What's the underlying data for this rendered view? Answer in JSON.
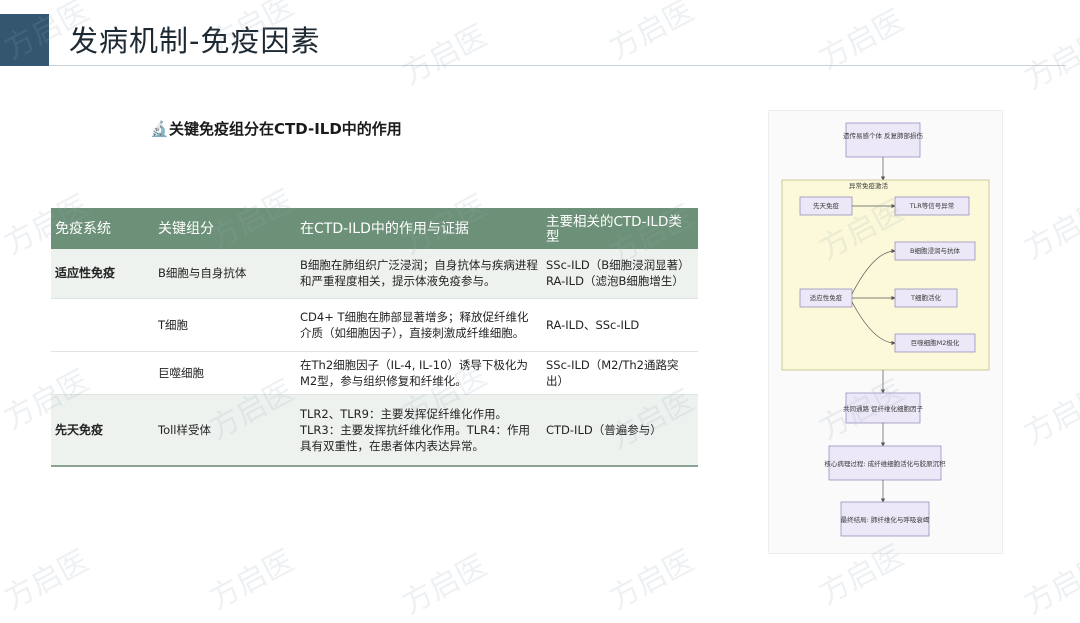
{
  "header": {
    "title": "发病机制-免疫因素"
  },
  "subtitle": {
    "icon": "microscope-icon",
    "glyph": "🔬",
    "text": "关键免疫组分在CTD-ILD中的作用"
  },
  "table": {
    "header_color": "#6d9178",
    "columns": [
      "免疫系统",
      "关键组分",
      "在CTD-ILD中的作用与证据",
      "主要相关的CTD-ILD类型"
    ],
    "rows": [
      {
        "system": "适应性免疫",
        "component": "B细胞与自身抗体",
        "role": "B细胞在肺组织广泛浸润；自身抗体与疾病进程和严重程度相关，提示体液免疫参与。",
        "type": "SSc-ILD（B细胞浸润显著）RA-ILD（滤泡B细胞增生）"
      },
      {
        "system": "",
        "component": "T细胞",
        "role": "CD4+ T细胞在肺部显著增多；释放促纤维化介质（如细胞因子），直接刺激成纤维细胞。",
        "type": "RA-ILD、SSc-ILD"
      },
      {
        "system": "",
        "component": "巨噬细胞",
        "role": "在Th2细胞因子（IL-4, IL-10）诱导下极化为M2型，参与组织修复和纤维化。",
        "type": "SSc-ILD（M2/Th2通路突出）"
      },
      {
        "system": "先天免疫",
        "component": "Toll样受体",
        "role": "TLR2、TLR9：主要发挥促纤维化作用。TLR3：主要发挥抗纤维化作用。TLR4：作用具有双重性，在患者体内表达异常。",
        "type": "CTD-ILD（普遍参与）"
      }
    ]
  },
  "flowchart": {
    "top_box": "遗传易感个体 反复肺部损伤",
    "group_label": "异常免疫激活",
    "innate_label": "先天免疫",
    "tlr_label": "TLR等信号异常",
    "adaptive_label": "适应性免疫",
    "b_cell_label": "B细胞浸润与抗体",
    "t_cell_label": "T细胞活化",
    "macro_label": "巨噬细胞M2极化",
    "pathway_box": "共同通路 促纤维化细胞因子",
    "core_box": "核心病理过程: 成纤维细胞活化与胶原沉积",
    "outcome_box": "最终结局: 肺纤维化与呼吸衰竭"
  },
  "watermark": {
    "text": "方启医"
  }
}
